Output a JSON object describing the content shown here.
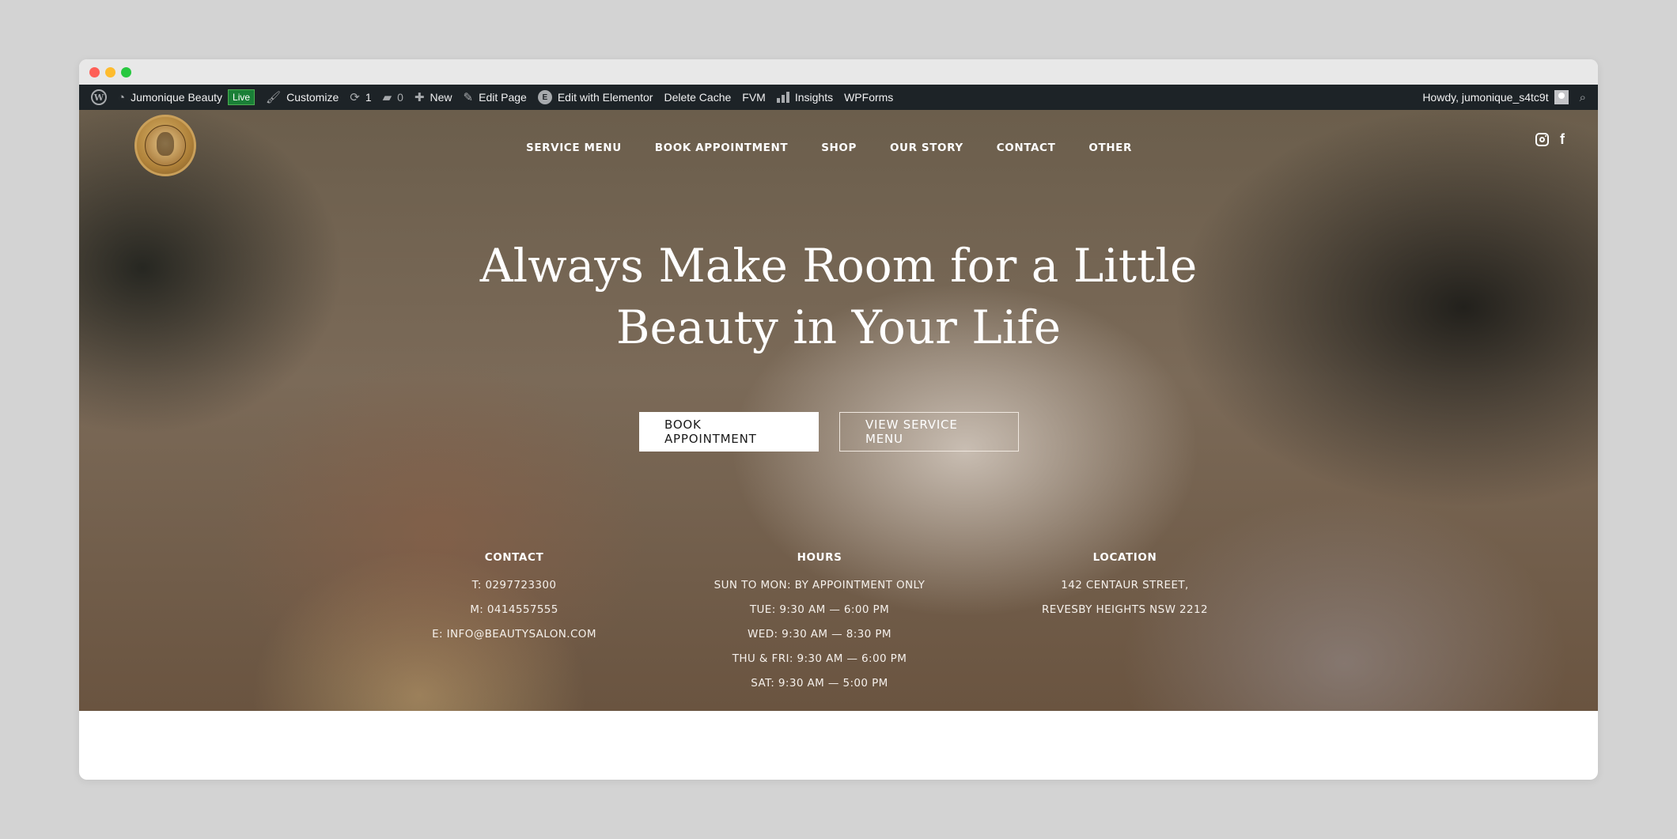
{
  "adminbar": {
    "site_name": "Jumonique Beauty",
    "live_badge": "Live",
    "customize": "Customize",
    "updates_count": "1",
    "comments_count": "0",
    "new": "New",
    "edit_page": "Edit Page",
    "edit_elementor": "Edit with Elementor",
    "delete_cache": "Delete Cache",
    "fvm": "FVM",
    "insights": "Insights",
    "wpforms": "WPForms",
    "howdy": "Howdy, jumonique_s4tc9t"
  },
  "nav": {
    "items": [
      "SERVICE MENU",
      "BOOK APPOINTMENT",
      "SHOP",
      "OUR STORY",
      "CONTACT",
      "OTHER"
    ]
  },
  "hero": {
    "headline_line1": "Always Make Room for a Little",
    "headline_line2": "Beauty in Your Life",
    "primary_button": "BOOK APPOINTMENT",
    "secondary_button": "VIEW SERVICE MENU"
  },
  "info": {
    "contact": {
      "title": "CONTACT",
      "lines": [
        "T: 0297723300",
        "M: 0414557555",
        "E: INFO@BEAUTYSALON.COM"
      ]
    },
    "hours": {
      "title": "HOURS",
      "lines": [
        "SUN TO MON: BY APPOINTMENT ONLY",
        "TUE: 9:30 AM — 6:00 PM",
        "WED: 9:30 AM — 8:30 PM",
        "THU & FRI: 9:30 AM — 6:00 PM",
        "SAT: 9:30 AM — 5:00 PM"
      ]
    },
    "location": {
      "title": "LOCATION",
      "lines": [
        "142 CENTAUR STREET,",
        "REVESBY HEIGHTS NSW 2212"
      ]
    }
  },
  "colors": {
    "adminbar_bg": "#1d2327",
    "live_badge": "#1a7f37",
    "button_primary_bg": "#ffffff",
    "text_on_hero": "#ffffff"
  }
}
